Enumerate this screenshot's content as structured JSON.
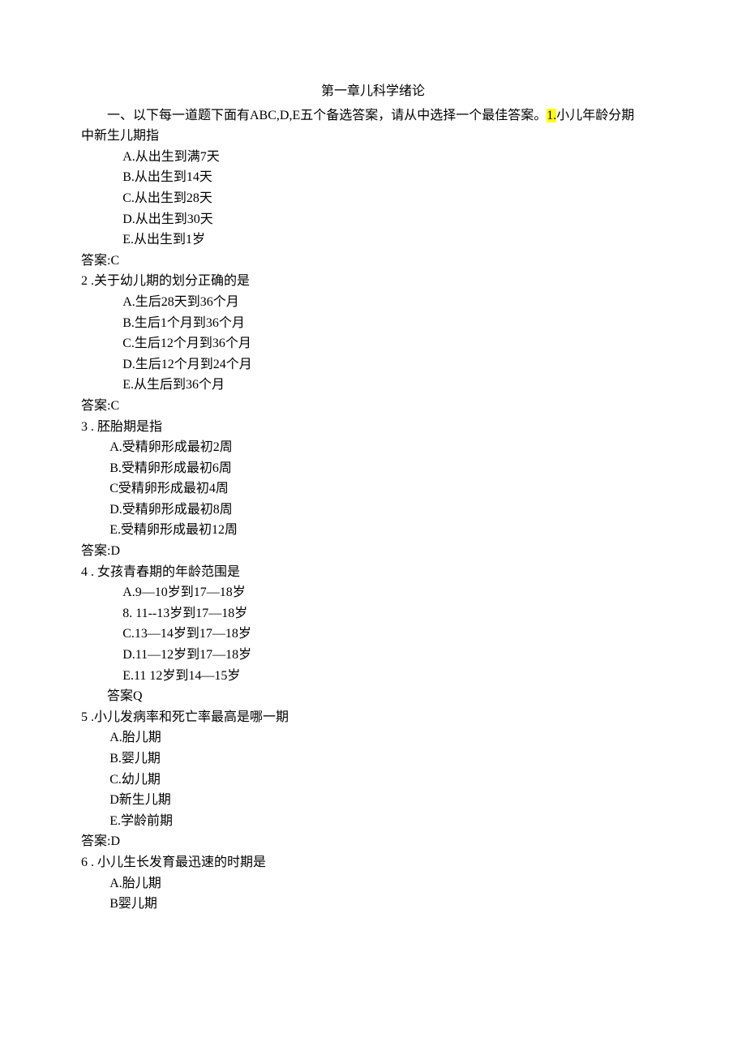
{
  "chapter_title": "第一章儿科学绪论",
  "intro_prefix": "一、以下每一道题下面有ABC,D,E五个备选答案，请从中选择一个最佳答案。",
  "intro_hl": "1.",
  "intro_suffix": "小儿年龄分期",
  "q1": {
    "stem_tail": "中新生儿期指",
    "opts": [
      "A.从出生到满7天",
      "B.从出生到14天",
      "C.从出生到28天",
      "D.从出生到30天",
      "E.从出生到1岁"
    ],
    "answer": "答案:C"
  },
  "q2": {
    "num": "2 .关于幼儿期的划分正确的是",
    "opts": [
      "A.生后28天到36个月",
      "B.生后1个月到36个月",
      "C.生后12个月到36个月",
      "D.生后12个月到24个月",
      "E.从生后到36个月"
    ],
    "answer": "答案:C"
  },
  "q3": {
    "num": "3 . 胚胎期是指",
    "opts": [
      "A.受精卵形成最初2周",
      "B.受精卵形成最初6周",
      "C受精卵形成最初4周",
      "D.受精卵形成最初8周",
      "E.受精卵形成最初12周"
    ],
    "answer": "答案:D"
  },
  "q4": {
    "num": "4 . 女孩青春期的年龄范围是",
    "opts": [
      "A.9—10岁到17—18岁",
      "8.   11--13岁到17—18岁",
      "C.13—14岁到17—18岁",
      "D.11—12岁到17—18岁",
      "E.11      12岁到14—15岁"
    ],
    "answer": "答案Q"
  },
  "q5": {
    "num": "5 .小儿发病率和死亡率最高是哪一期",
    "opts": [
      "A.胎儿期",
      "B.婴儿期",
      "C.幼儿期",
      "D新生儿期",
      "E.学龄前期"
    ],
    "answer": "答案:D"
  },
  "q6": {
    "num": "6 . 小儿生长发育最迅速的时期是",
    "opts": [
      "A.胎儿期",
      "B婴儿期"
    ]
  }
}
